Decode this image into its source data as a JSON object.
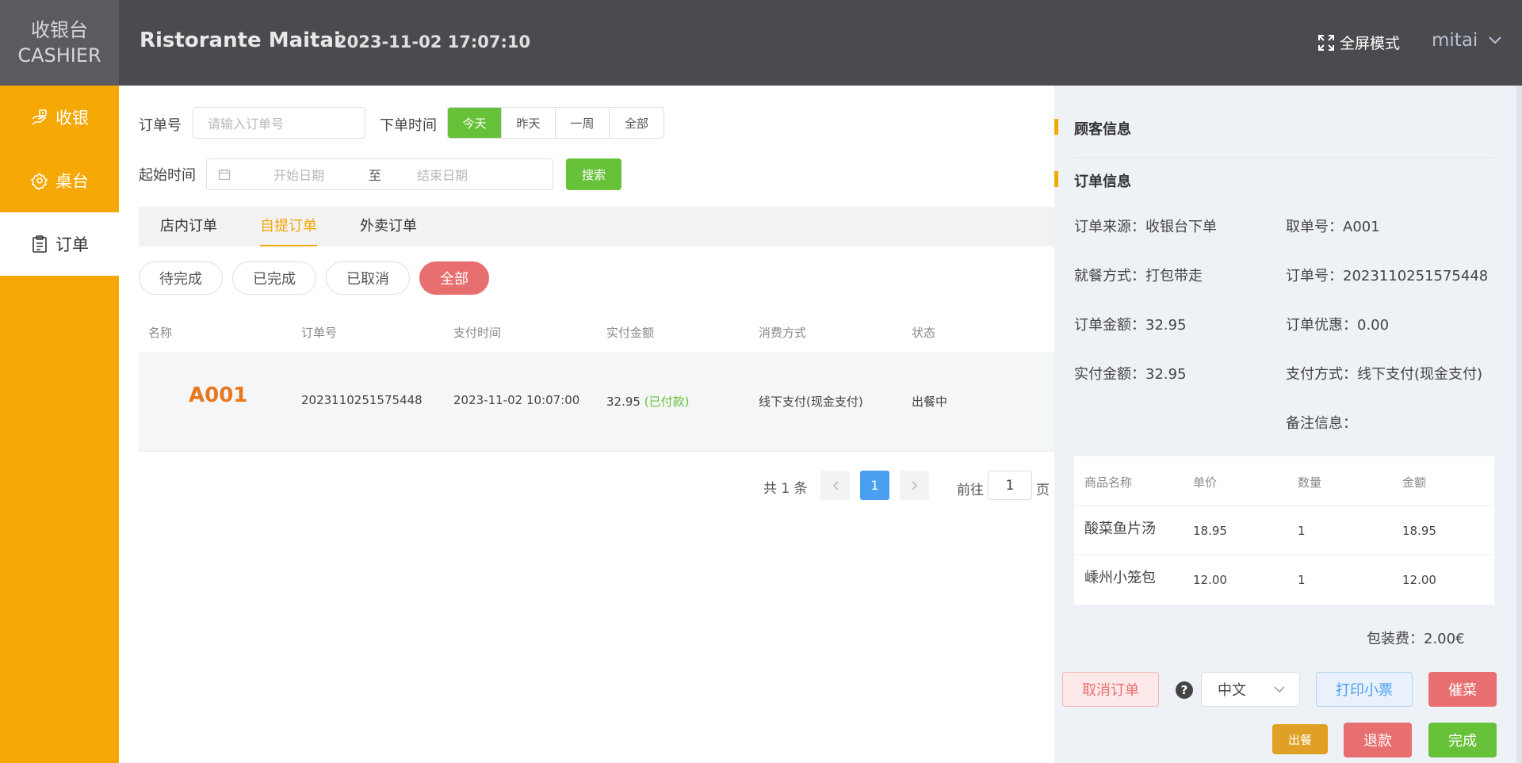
{
  "header": {
    "logo_line1": "收银台",
    "logo_line2": "CASHIER",
    "restaurant": "Ristorante Maitai",
    "datetime": "2023-11-02 17:07:10",
    "fullscreen_label": "全屏模式",
    "user": "mitai"
  },
  "sidebar": {
    "items": [
      {
        "label": "收银",
        "icon": "cashier-icon"
      },
      {
        "label": "桌台",
        "icon": "table-icon"
      },
      {
        "label": "订单",
        "icon": "order-icon"
      }
    ]
  },
  "filters": {
    "order_no_label": "订单号",
    "order_no_placeholder": "请输入订单号",
    "time_label": "下单时间",
    "time_options": [
      "今天",
      "昨天",
      "一周",
      "全部"
    ],
    "time_selected": "今天",
    "start_label": "起始时间",
    "start_placeholder": "开始日期",
    "range_sep": "至",
    "end_placeholder": "结束日期",
    "search_label": "搜索"
  },
  "tabs": [
    "店内订单",
    "自提订单",
    "外卖订单"
  ],
  "active_tab": "自提订单",
  "status_pills": [
    "待完成",
    "已完成",
    "已取消",
    "全部"
  ],
  "active_pill": "全部",
  "table": {
    "headers": [
      "名称",
      "订单号",
      "支付时间",
      "实付金额",
      "消费方式",
      "状态"
    ],
    "rows": [
      {
        "name": "A001",
        "order_no": "2023110251575448",
        "paid_time": "2023-11-02 10:07:00",
        "amount": "32.95",
        "paid_tag": "(已付款)",
        "method": "线下支付(现金支付)",
        "status": "出餐中"
      }
    ]
  },
  "pagination": {
    "total": "共 1 条",
    "current": "1",
    "goto_label": "前往",
    "goto_value": "1",
    "page_suffix": "页"
  },
  "detail": {
    "customer_title": "顾客信息",
    "order_title": "订单信息",
    "source": "订单来源：收银台下单",
    "pickup_no": "取单号：A001",
    "dining": "就餐方式：打包带走",
    "order_no": "订单号：2023110251575448",
    "order_amount": "订单金额：32.95",
    "discount": "订单优惠：0.00",
    "paid_amount": "实付金额：32.95",
    "pay_method": "支付方式：线下支付(现金支付)",
    "remark": "备注信息：",
    "item_headers": [
      "商品名称",
      "单价",
      "数量",
      "金额"
    ],
    "items": [
      {
        "name": "酸菜鱼片汤",
        "price": "18.95",
        "qty": "1",
        "total": "18.95"
      },
      {
        "name": "嵊州小笼包",
        "price": "12.00",
        "qty": "1",
        "total": "12.00"
      }
    ],
    "packing_fee": "包装费：2.00€",
    "buttons": {
      "cancel": "取消订单",
      "help": "?",
      "language": "中文",
      "print": "打印小票",
      "urge": "催菜",
      "serve": "出餐",
      "refund": "退款",
      "done": "完成"
    }
  },
  "colors": {
    "accent": "#f5a704",
    "header": "#4a4a4f",
    "green": "#67c23a",
    "red": "#e86f6f",
    "blue": "#4a9ff0"
  }
}
